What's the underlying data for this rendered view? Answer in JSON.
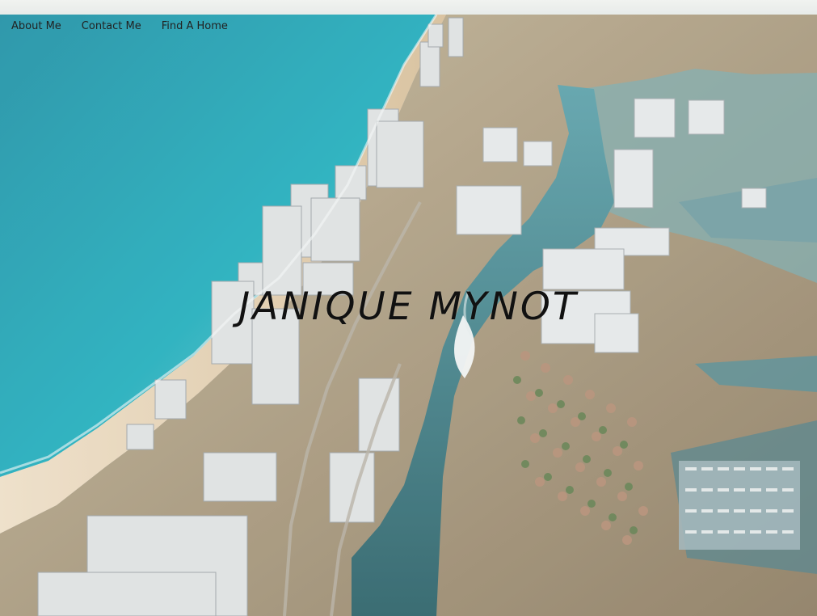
{
  "nav": {
    "items": [
      {
        "label": "About Me"
      },
      {
        "label": "Contact Me"
      },
      {
        "label": "Find A Home"
      }
    ]
  },
  "hero": {
    "title": "JANIQUE MYNOT",
    "image_subject": "aerial-coastline-city",
    "palette": {
      "ocean": "#1aa3b3",
      "deep_ocean": "#177b8d",
      "sand": "#e7d3b8",
      "waterway": "#2f6770",
      "land": "#9b8f75",
      "sky_haze": "#e9efef"
    }
  }
}
